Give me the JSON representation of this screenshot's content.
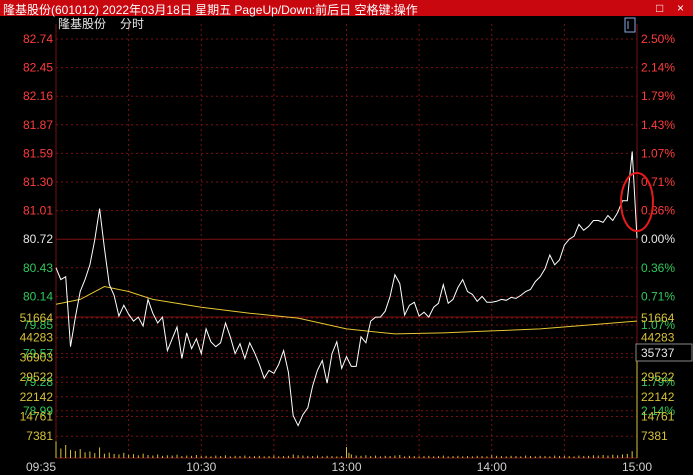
{
  "window": {
    "title": "隆基股份(601012)  2022年03月18日  星期五  PageUp/Down:前后日  空格键:操作",
    "minimize_glyph": "□",
    "close_glyph": "×"
  },
  "chart_header": {
    "stock_name": "隆基股份",
    "mode": "分时"
  },
  "icons": {
    "toggle": "square-icon"
  },
  "colors": {
    "background": "#000000",
    "price_line": "#ffffff",
    "avg_line": "#e6c632",
    "up": "#ff3c3c",
    "down": "#31c95b",
    "flat": "#e6e6e6",
    "volume": "#d8c23a",
    "grid": "#7a1010",
    "annotation": "#e51a1a"
  },
  "chart_data": [
    {
      "type": "line",
      "title": "",
      "prev_close": 80.72,
      "ylim": [
        78.7,
        82.74
      ],
      "y_ticks": [
        "82.74",
        "82.45",
        "82.16",
        "81.87",
        "81.59",
        "81.30",
        "81.01",
        "80.72",
        "80.43",
        "80.14",
        "79.85",
        "79.57",
        "79.28",
        "78.99"
      ],
      "y_ticks_pct": [
        "2.50%",
        "2.14%",
        "1.79%",
        "1.43%",
        "1.07%",
        "0.71%",
        "0.36%",
        "0.00%",
        "0.36%",
        "0.71%",
        "1.07%",
        "1.43%",
        "1.79%",
        "2.14%"
      ],
      "x_ticks": [
        "09:35",
        "10:30",
        "13:00",
        "14:00",
        "15:00"
      ],
      "x_tick_minutes": [
        5,
        60,
        120,
        180,
        240
      ],
      "session_minutes": 240,
      "series": [
        {
          "key": "price",
          "x": [
            0,
            2,
            4,
            6,
            8,
            10,
            12,
            14,
            16,
            18,
            20,
            22,
            24,
            26,
            28,
            30,
            32,
            34,
            36,
            38,
            40,
            42,
            44,
            46,
            48,
            50,
            52,
            54,
            56,
            58,
            60,
            62,
            64,
            66,
            68,
            70,
            72,
            74,
            76,
            78,
            80,
            82,
            84,
            86,
            88,
            90,
            92,
            94,
            96,
            98,
            100,
            102,
            104,
            106,
            108,
            110,
            112,
            114,
            116,
            118,
            120,
            122,
            124,
            126,
            128,
            130,
            132,
            134,
            136,
            138,
            140,
            142,
            144,
            146,
            148,
            150,
            152,
            154,
            156,
            158,
            160,
            162,
            164,
            166,
            168,
            170,
            172,
            174,
            176,
            178,
            180,
            182,
            184,
            186,
            188,
            190,
            192,
            194,
            196,
            198,
            200,
            202,
            204,
            206,
            208,
            210,
            212,
            214,
            216,
            218,
            220,
            222,
            224,
            226,
            228,
            230,
            232,
            234,
            236,
            238,
            240
          ],
          "values": [
            80.42,
            80.3,
            80.33,
            79.62,
            79.92,
            80.18,
            80.3,
            80.45,
            80.7,
            81.02,
            80.62,
            80.25,
            80.14,
            79.93,
            80.04,
            79.95,
            79.88,
            79.92,
            79.83,
            80.1,
            79.96,
            79.86,
            79.92,
            79.58,
            79.7,
            79.82,
            79.5,
            79.76,
            79.6,
            79.7,
            79.55,
            79.8,
            79.67,
            79.62,
            79.66,
            79.86,
            79.72,
            79.55,
            79.65,
            79.5,
            79.66,
            79.56,
            79.44,
            79.3,
            79.38,
            79.35,
            79.44,
            79.58,
            79.36,
            78.92,
            78.82,
            78.93,
            79.0,
            79.22,
            79.38,
            79.48,
            79.25,
            79.55,
            79.67,
            79.4,
            79.52,
            79.42,
            79.42,
            79.72,
            79.66,
            79.88,
            79.92,
            79.92,
            79.98,
            80.13,
            80.35,
            80.26,
            79.94,
            80.04,
            80.07,
            79.93,
            79.97,
            79.92,
            80.02,
            80.06,
            80.25,
            80.06,
            80.1,
            80.22,
            80.3,
            80.18,
            80.15,
            80.08,
            80.13,
            80.07,
            80.07,
            80.08,
            80.1,
            80.09,
            80.12,
            80.11,
            80.14,
            80.18,
            80.2,
            80.28,
            80.33,
            80.41,
            80.55,
            80.45,
            80.5,
            80.65,
            80.71,
            80.74,
            80.86,
            80.8,
            80.84,
            80.9,
            80.9,
            80.88,
            80.95,
            80.9,
            80.98,
            81.1,
            81.1,
            81.6,
            80.72
          ],
          "values_note_removed": true
        },
        {
          "key": "average",
          "x": [
            0,
            10,
            20,
            30,
            40,
            60,
            80,
            100,
            120,
            140,
            160,
            180,
            200,
            220,
            240
          ],
          "values": [
            80.05,
            80.1,
            80.23,
            80.18,
            80.1,
            80.02,
            79.96,
            79.91,
            79.8,
            79.75,
            79.76,
            79.78,
            79.8,
            79.84,
            79.88
          ]
        }
      ]
    },
    {
      "type": "bar",
      "title": "",
      "ylim": [
        0,
        51664
      ],
      "y_ticks": [
        "51664",
        "44283",
        "36903",
        "29522",
        "22142",
        "14761",
        "7381"
      ],
      "current_volume_label": "35737",
      "bars": [
        {
          "x": 0,
          "v": 6200
        },
        {
          "x": 2,
          "v": 3500
        },
        {
          "x": 4,
          "v": 4800
        },
        {
          "x": 6,
          "v": 3000
        },
        {
          "x": 8,
          "v": 2600
        },
        {
          "x": 10,
          "v": 3300
        },
        {
          "x": 12,
          "v": 2100
        },
        {
          "x": 14,
          "v": 2400
        },
        {
          "x": 16,
          "v": 1800
        },
        {
          "x": 18,
          "v": 3900
        },
        {
          "x": 20,
          "v": 1600
        },
        {
          "x": 22,
          "v": 2000
        },
        {
          "x": 24,
          "v": 1500
        },
        {
          "x": 26,
          "v": 1300
        },
        {
          "x": 28,
          "v": 1900
        },
        {
          "x": 30,
          "v": 1200
        },
        {
          "x": 32,
          "v": 1400
        },
        {
          "x": 34,
          "v": 1000
        },
        {
          "x": 36,
          "v": 1600
        },
        {
          "x": 38,
          "v": 1100
        },
        {
          "x": 40,
          "v": 900
        },
        {
          "x": 42,
          "v": 1300
        },
        {
          "x": 44,
          "v": 800
        },
        {
          "x": 46,
          "v": 1000
        },
        {
          "x": 48,
          "v": 900
        },
        {
          "x": 50,
          "v": 1200
        },
        {
          "x": 52,
          "v": 700
        },
        {
          "x": 54,
          "v": 900
        },
        {
          "x": 56,
          "v": 800
        },
        {
          "x": 58,
          "v": 1100
        },
        {
          "x": 60,
          "v": 700
        },
        {
          "x": 62,
          "v": 800
        },
        {
          "x": 64,
          "v": 600
        },
        {
          "x": 66,
          "v": 900
        },
        {
          "x": 68,
          "v": 700
        },
        {
          "x": 70,
          "v": 1000
        },
        {
          "x": 72,
          "v": 600
        },
        {
          "x": 74,
          "v": 800
        },
        {
          "x": 76,
          "v": 700
        },
        {
          "x": 78,
          "v": 900
        },
        {
          "x": 80,
          "v": 600
        },
        {
          "x": 82,
          "v": 700
        },
        {
          "x": 84,
          "v": 800
        },
        {
          "x": 86,
          "v": 600
        },
        {
          "x": 88,
          "v": 700
        },
        {
          "x": 90,
          "v": 900
        },
        {
          "x": 92,
          "v": 600
        },
        {
          "x": 94,
          "v": 700
        },
        {
          "x": 96,
          "v": 800
        },
        {
          "x": 98,
          "v": 1300
        },
        {
          "x": 100,
          "v": 1000
        },
        {
          "x": 102,
          "v": 900
        },
        {
          "x": 104,
          "v": 800
        },
        {
          "x": 106,
          "v": 700
        },
        {
          "x": 108,
          "v": 900
        },
        {
          "x": 110,
          "v": 600
        },
        {
          "x": 112,
          "v": 800
        },
        {
          "x": 114,
          "v": 700
        },
        {
          "x": 116,
          "v": 600
        },
        {
          "x": 118,
          "v": 700
        },
        {
          "x": 120,
          "v": 4000
        },
        {
          "x": 121,
          "v": 1900
        },
        {
          "x": 122,
          "v": 1300
        },
        {
          "x": 124,
          "v": 900
        },
        {
          "x": 126,
          "v": 800
        },
        {
          "x": 128,
          "v": 1000
        },
        {
          "x": 130,
          "v": 700
        },
        {
          "x": 132,
          "v": 900
        },
        {
          "x": 134,
          "v": 600
        },
        {
          "x": 136,
          "v": 800
        },
        {
          "x": 138,
          "v": 700
        },
        {
          "x": 140,
          "v": 900
        },
        {
          "x": 142,
          "v": 1100
        },
        {
          "x": 144,
          "v": 600
        },
        {
          "x": 146,
          "v": 800
        },
        {
          "x": 148,
          "v": 700
        },
        {
          "x": 150,
          "v": 600
        },
        {
          "x": 152,
          "v": 700
        },
        {
          "x": 154,
          "v": 800
        },
        {
          "x": 156,
          "v": 600
        },
        {
          "x": 158,
          "v": 700
        },
        {
          "x": 160,
          "v": 900
        },
        {
          "x": 162,
          "v": 600
        },
        {
          "x": 164,
          "v": 700
        },
        {
          "x": 166,
          "v": 800
        },
        {
          "x": 168,
          "v": 600
        },
        {
          "x": 170,
          "v": 700
        },
        {
          "x": 172,
          "v": 600
        },
        {
          "x": 174,
          "v": 800
        },
        {
          "x": 176,
          "v": 700
        },
        {
          "x": 178,
          "v": 600
        },
        {
          "x": 180,
          "v": 1000
        },
        {
          "x": 182,
          "v": 800
        },
        {
          "x": 184,
          "v": 700
        },
        {
          "x": 186,
          "v": 600
        },
        {
          "x": 188,
          "v": 800
        },
        {
          "x": 190,
          "v": 700
        },
        {
          "x": 192,
          "v": 600
        },
        {
          "x": 194,
          "v": 900
        },
        {
          "x": 196,
          "v": 700
        },
        {
          "x": 198,
          "v": 600
        },
        {
          "x": 200,
          "v": 800
        },
        {
          "x": 202,
          "v": 700
        },
        {
          "x": 204,
          "v": 600
        },
        {
          "x": 206,
          "v": 900
        },
        {
          "x": 208,
          "v": 700
        },
        {
          "x": 210,
          "v": 800
        },
        {
          "x": 212,
          "v": 700
        },
        {
          "x": 214,
          "v": 600
        },
        {
          "x": 216,
          "v": 900
        },
        {
          "x": 218,
          "v": 700
        },
        {
          "x": 220,
          "v": 800
        },
        {
          "x": 222,
          "v": 1000
        },
        {
          "x": 224,
          "v": 900
        },
        {
          "x": 226,
          "v": 1100
        },
        {
          "x": 228,
          "v": 900
        },
        {
          "x": 230,
          "v": 1200
        },
        {
          "x": 232,
          "v": 1000
        },
        {
          "x": 234,
          "v": 1300
        },
        {
          "x": 236,
          "v": 1500
        },
        {
          "x": 238,
          "v": 2500
        },
        {
          "x": 240,
          "v": 35737
        }
      ]
    }
  ]
}
